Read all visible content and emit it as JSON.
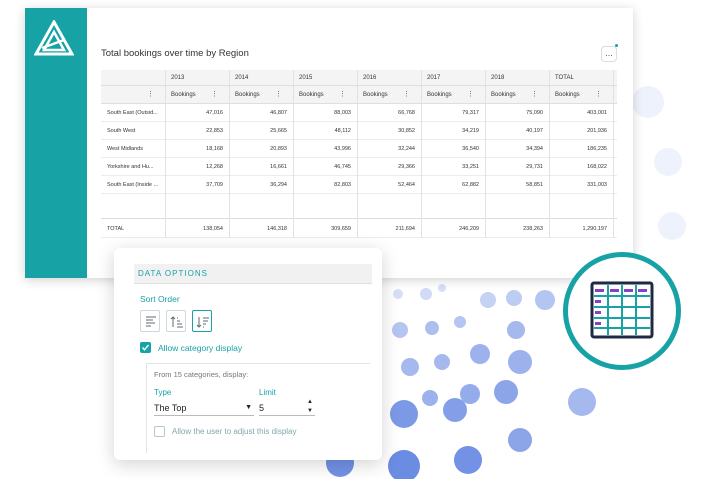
{
  "report": {
    "title": "Total bookings over time by Region",
    "more_label": "...",
    "columns": [
      "2013",
      "2014",
      "2015",
      "2016",
      "2017",
      "2018",
      "TOTAL"
    ],
    "measure_label": "Bookings",
    "rows": [
      {
        "label": "South East (Outsid...",
        "values": [
          "47,016",
          "46,807",
          "88,003",
          "66,768",
          "79,317",
          "75,090",
          "403,001"
        ]
      },
      {
        "label": "South West",
        "values": [
          "22,853",
          "25,665",
          "48,112",
          "30,852",
          "34,219",
          "40,197",
          "201,936"
        ]
      },
      {
        "label": "West Midlands",
        "values": [
          "18,168",
          "20,893",
          "43,996",
          "32,244",
          "36,540",
          "34,394",
          "186,235"
        ]
      },
      {
        "label": "Yorkshire and Hu...",
        "values": [
          "12,268",
          "16,661",
          "46,745",
          "29,366",
          "33,251",
          "29,731",
          "168,022"
        ]
      },
      {
        "label": "South East (Inside ...",
        "values": [
          "37,709",
          "36,294",
          "82,803",
          "52,464",
          "62,882",
          "58,851",
          "331,003"
        ]
      }
    ],
    "total_row": {
      "label": "TOTAL",
      "values": [
        "138,054",
        "146,318",
        "309,659",
        "211,694",
        "246,209",
        "238,263",
        "1,290,197"
      ]
    }
  },
  "data_options": {
    "title": "DATA OPTIONS",
    "sort_order_label": "Sort Order",
    "allow_category_label": "Allow category display",
    "allow_category_checked": true,
    "from_categories_label": "From 15 categories, display:",
    "type_label": "Type",
    "type_value": "The Top",
    "limit_label": "Limit",
    "limit_value": "5",
    "adjust_label": "Allow the user to adjust this display",
    "adjust_checked": false
  },
  "colors": {
    "accent": "#17a2a6",
    "dots": "#5b7fe0",
    "icon_purple": "#8a3fc9"
  },
  "icons": {
    "logo": "triangle-logo-icon",
    "badge": "table-grid-icon"
  }
}
